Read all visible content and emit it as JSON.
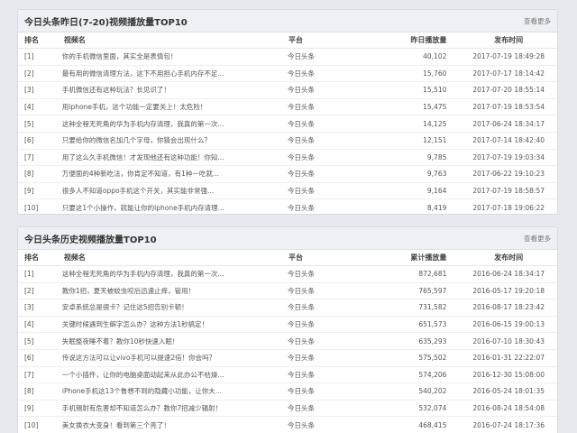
{
  "panels": [
    {
      "title": "今日头条昨日(7-20)视频播放量TOP10",
      "more": "查看更多",
      "headers": {
        "rank": "排名",
        "name": "视频名",
        "platform": "平台",
        "count": "昨日播放量",
        "date": "发布时间"
      },
      "rows": [
        {
          "rank": "[1]",
          "name": "你的手机微信里面，其实全是表情包！",
          "platform": "今日头条",
          "count": "40,102",
          "date": "2017-07-19 18:49:28"
        },
        {
          "rank": "[2]",
          "name": "最有用的微信清理方法，这下不用担心手机内存不足...",
          "platform": "今日头条",
          "count": "15,760",
          "date": "2017-07-17 18:14:42"
        },
        {
          "rank": "[3]",
          "name": "手机微信还有这种玩法？长见识了！",
          "platform": "今日头条",
          "count": "15,510",
          "date": "2017-07-20 18:55:14"
        },
        {
          "rank": "[4]",
          "name": "用iphone手机，这个功能一定要关上！太危险！",
          "platform": "今日头条",
          "count": "15,475",
          "date": "2017-07-19 18:53:54"
        },
        {
          "rank": "[5]",
          "name": "这种全程无死角的华为手机内存清理，我真的第一次...",
          "platform": "今日头条",
          "count": "14,125",
          "date": "2017-06-24 18:34:17"
        },
        {
          "rank": "[6]",
          "name": "只要给你的微信名加几个字母，你猜会出现什么？",
          "platform": "今日头条",
          "count": "12,151",
          "date": "2017-07-14 18:42:40"
        },
        {
          "rank": "[7]",
          "name": "用了这么久手机微信！才发现他还有这种功能！你知...",
          "platform": "今日头条",
          "count": "9,785",
          "date": "2017-07-19 19:03:34"
        },
        {
          "rank": "[8]",
          "name": "万便面的4种新吃法，你肯定不知道，有1种一吃就...",
          "platform": "今日头条",
          "count": "9,763",
          "date": "2017-06-22 19:10:23"
        },
        {
          "rank": "[9]",
          "name": "很多人不知道oppo手机这个开关，其实能非常强...",
          "platform": "今日头条",
          "count": "9,164",
          "date": "2017-07-19 18:58:57"
        },
        {
          "rank": "[10]",
          "name": "只要这1个小操作，就能让你的iphone手机内存清理...",
          "platform": "今日头条",
          "count": "8,419",
          "date": "2017-07-18 19:06:22"
        }
      ]
    },
    {
      "title": "今日头条历史视频播放量TOP10",
      "more": "查看更多",
      "headers": {
        "rank": "排名",
        "name": "视频名",
        "platform": "平台",
        "count": "累计播放量",
        "date": "发布时间"
      },
      "rows": [
        {
          "rank": "[1]",
          "name": "这种全程无死角的华为手机内存清理，我真的第一次...",
          "platform": "今日头条",
          "count": "872,681",
          "date": "2016-06-24 18:34:17"
        },
        {
          "rank": "[2]",
          "name": "教你1招，夏天被蚊虫咬后迅速止痒，管用！",
          "platform": "今日头条",
          "count": "765,597",
          "date": "2016-05-17 19:20:18"
        },
        {
          "rank": "[3]",
          "name": "安卓系统总是很卡？记住这5招告别卡顿！",
          "platform": "今日头条",
          "count": "731,582",
          "date": "2016-08-17 18:23:42"
        },
        {
          "rank": "[4]",
          "name": "关键时候遇到生僻字怎么办？这种方法1秒搞定！",
          "platform": "今日头条",
          "count": "651,573",
          "date": "2016-06-15 19:00:13"
        },
        {
          "rank": "[5]",
          "name": "失眠整夜睡不着？教你10秒快速入眠！",
          "platform": "今日头条",
          "count": "635,293",
          "date": "2016-07-10 18:30:43"
        },
        {
          "rank": "[6]",
          "name": "传说这方法可以让vivo手机可以提速2倍！你会吗？",
          "platform": "今日头条",
          "count": "575,502",
          "date": "2016-01-31 22:22:07"
        },
        {
          "rank": "[7]",
          "name": "一个小插件，让你的电脑桌面动起来从此办公不枯燥...",
          "platform": "今日头条",
          "count": "574,206",
          "date": "2016-12-30 15:08:00"
        },
        {
          "rank": "[8]",
          "name": "iPhone手机这13个鲁想不到的隐藏小功能，让你大...",
          "platform": "今日头条",
          "count": "540,202",
          "date": "2016-05-24 18:01:35"
        },
        {
          "rank": "[9]",
          "name": "手机锡射有危害却不知道怎么办？教你7招减少辐射！",
          "platform": "今日头条",
          "count": "532,074",
          "date": "2016-08-24 18:54:08"
        },
        {
          "rank": "[10]",
          "name": "美女换衣大变身！看到第三个亮了！",
          "platform": "今日头条",
          "count": "468,415",
          "date": "2016-07-24 18:17:36"
        }
      ]
    }
  ]
}
